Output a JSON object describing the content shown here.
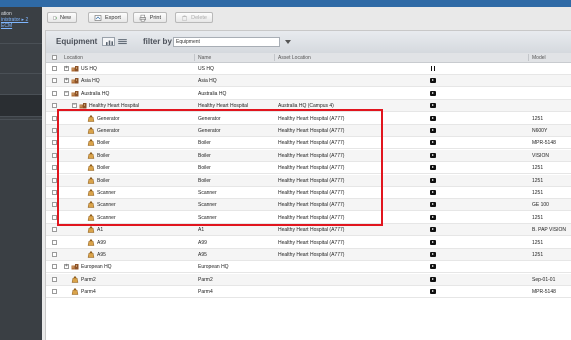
{
  "sidebar": {
    "lines": [
      "ation",
      "inistrator ▸ 2",
      "ECM"
    ]
  },
  "toolbar": {
    "new_label": "New",
    "export_label": "Export",
    "print_label": "Print",
    "delete_label": "Delete"
  },
  "panel": {
    "title": "Equipment",
    "filter_label": "filter by",
    "filter_value": "Equipment"
  },
  "columns": [
    "Location",
    "Name",
    "Asset Location",
    "Model"
  ],
  "rows": [
    {
      "indent": 1,
      "expander": "+",
      "icon": "building",
      "location": "US HQ",
      "name": "US HQ",
      "asset": "",
      "status": "pause",
      "model": ""
    },
    {
      "indent": 1,
      "expander": "+",
      "icon": "building",
      "location": "Asia HQ",
      "name": "Asia HQ",
      "asset": "",
      "status": "play",
      "model": ""
    },
    {
      "indent": 1,
      "expander": "−",
      "icon": "building",
      "location": "Australia HQ",
      "name": "Australia HQ",
      "asset": "",
      "status": "play",
      "model": ""
    },
    {
      "indent": 2,
      "expander": "−",
      "icon": "building",
      "location": "Healthy Heart Hospital",
      "name": "Healthy Heart Hospital",
      "asset": "Australia HQ (Campus 4)",
      "status": "play",
      "model": ""
    },
    {
      "indent": 3,
      "expander": "",
      "icon": "asset",
      "location": "Generator",
      "name": "Generator",
      "asset": "Healthy Heart Hospital (A777)",
      "status": "play",
      "model": "1251"
    },
    {
      "indent": 3,
      "expander": "",
      "icon": "asset",
      "location": "Generator",
      "name": "Generator",
      "asset": "Healthy Heart Hospital (A777)",
      "status": "play",
      "model": "N600Y"
    },
    {
      "indent": 3,
      "expander": "",
      "icon": "asset",
      "location": "Boiler",
      "name": "Boiler",
      "asset": "Healthy Heart Hospital (A777)",
      "status": "play",
      "model": "MPR-5148"
    },
    {
      "indent": 3,
      "expander": "",
      "icon": "asset",
      "location": "Boiler",
      "name": "Boiler",
      "asset": "Healthy Heart Hospital (A777)",
      "status": "play",
      "model": "VISION"
    },
    {
      "indent": 3,
      "expander": "",
      "icon": "asset",
      "location": "Boiler",
      "name": "Boiler",
      "asset": "Healthy Heart Hospital (A777)",
      "status": "play",
      "model": "1251"
    },
    {
      "indent": 3,
      "expander": "",
      "icon": "asset",
      "location": "Boiler",
      "name": "Boiler",
      "asset": "Healthy Heart Hospital (A777)",
      "status": "play",
      "model": "1251"
    },
    {
      "indent": 3,
      "expander": "",
      "icon": "asset",
      "location": "Scanner",
      "name": "Scanner",
      "asset": "Healthy Heart Hospital (A777)",
      "status": "play",
      "model": "1251"
    },
    {
      "indent": 3,
      "expander": "",
      "icon": "asset",
      "location": "Scanner",
      "name": "Scanner",
      "asset": "Healthy Heart Hospital (A777)",
      "status": "play",
      "model": "GE 100"
    },
    {
      "indent": 3,
      "expander": "",
      "icon": "asset",
      "location": "Scanner",
      "name": "Scanner",
      "asset": "Healthy Heart Hospital (A777)",
      "status": "play",
      "model": "1251"
    },
    {
      "indent": 3,
      "expander": "",
      "icon": "asset",
      "location": "A1",
      "name": "A1",
      "asset": "Healthy Heart Hospital (A777)",
      "status": "play",
      "model": "B. PAP VISION"
    },
    {
      "indent": 3,
      "expander": "",
      "icon": "asset",
      "location": "A99",
      "name": "A99",
      "asset": "Healthy Heart Hospital (A777)",
      "status": "play",
      "model": "1251"
    },
    {
      "indent": 3,
      "expander": "",
      "icon": "asset",
      "location": "A95",
      "name": "A95",
      "asset": "Healthy Heart Hospital (A777)",
      "status": "play",
      "model": "1251"
    },
    {
      "indent": 1,
      "expander": "+",
      "icon": "building",
      "location": "European HQ",
      "name": "European HQ",
      "asset": "",
      "status": "play",
      "model": ""
    },
    {
      "indent": 1,
      "expander": "",
      "icon": "asset",
      "location": "Parm2",
      "name": "Parm2",
      "asset": "",
      "status": "play",
      "model": "Sep-01-01"
    },
    {
      "indent": 1,
      "expander": "",
      "icon": "asset",
      "location": "Parm4",
      "name": "Parm4",
      "asset": "",
      "status": "play",
      "model": "MPR-5148"
    }
  ],
  "colors": {
    "highlight": "#e1151e",
    "topbar": "#2f6aa6",
    "sidebar": "#3a3f44"
  }
}
